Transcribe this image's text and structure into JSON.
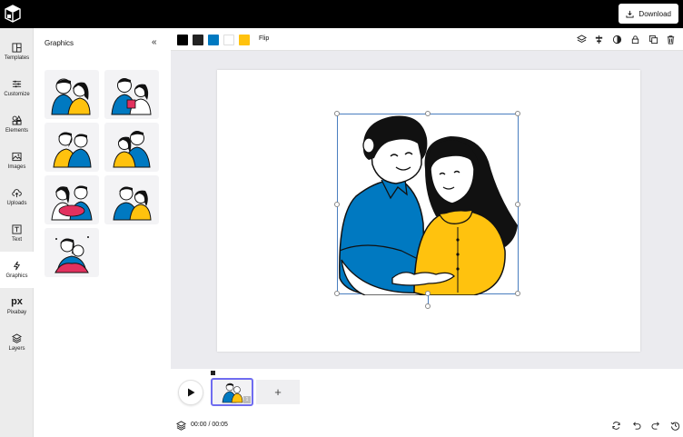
{
  "topbar": {
    "download_label": "Download"
  },
  "rail": {
    "items": [
      {
        "label": "Templates",
        "icon": "templates-icon"
      },
      {
        "label": "Customize",
        "icon": "sliders-icon"
      },
      {
        "label": "Elements",
        "icon": "shapes-icon"
      },
      {
        "label": "Images",
        "icon": "image-icon"
      },
      {
        "label": "Uploads",
        "icon": "cloud-upload-icon"
      },
      {
        "label": "Text",
        "icon": "text-icon"
      },
      {
        "label": "Graphics",
        "icon": "graphics-icon",
        "active": true
      },
      {
        "label": "Pixabay",
        "icon": "pixabay-icon",
        "glyph": "px"
      },
      {
        "label": "Layers",
        "icon": "layers-icon"
      }
    ]
  },
  "panel": {
    "title": "Graphics",
    "collapse_glyph": "«"
  },
  "toolbar": {
    "swatches": [
      "#000000",
      "#222222",
      "#0079c1",
      "#ffffff",
      "#ffc20e"
    ],
    "flip_label": "Flip"
  },
  "timeline": {
    "scene_number": "1",
    "add_glyph": "+"
  },
  "bottom": {
    "time": "00:00 / 00:05"
  },
  "colors": {
    "blue": "#0079c1",
    "yellow": "#ffc20e",
    "accent": "#6f6cf0",
    "selection": "#4a7ebf"
  }
}
